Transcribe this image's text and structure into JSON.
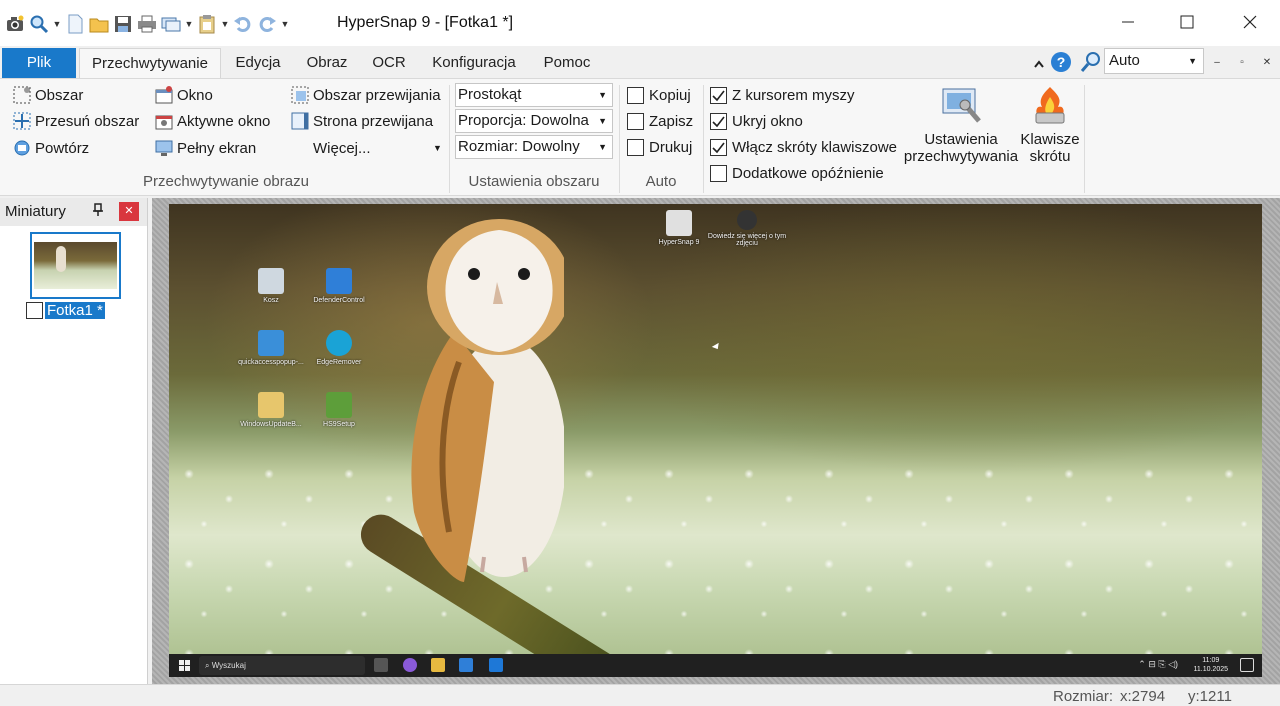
{
  "window": {
    "title": "HyperSnap 9 - [Fotka1 *]",
    "controls": [
      "minimize",
      "maximize",
      "close"
    ]
  },
  "quick_access": {
    "icons": [
      "camera-icon",
      "zoom-icon",
      "new-icon",
      "open-icon",
      "save-icon",
      "print-icon",
      "windows-icon",
      "clipboard-icon",
      "undo-icon",
      "redo-icon",
      "customize-icon"
    ]
  },
  "tabs": {
    "file": "Plik",
    "items": [
      "Przechwytywanie",
      "Edycja",
      "Obraz",
      "OCR",
      "Konfiguracja",
      "Pomoc"
    ],
    "active": "Przechwytywanie"
  },
  "zoom_select": {
    "value": "Auto"
  },
  "ribbon": {
    "capture_group": {
      "label": "Przechwytywanie obrazu",
      "col1": [
        "Obszar",
        "Przesuń obszar",
        "Powtórz"
      ],
      "col2": [
        "Okno",
        "Aktywne okno",
        "Pełny ekran"
      ],
      "col3": [
        "Obszar przewijania",
        "Strona przewijana",
        "Więcej..."
      ]
    },
    "area_group": {
      "label": "Ustawienia obszaru",
      "dropdowns": [
        "Prostokąt",
        "Proporcja: Dowolna",
        "Rozmiar: Dowolny"
      ]
    },
    "auto_group": {
      "label": "Auto",
      "checkboxes": [
        {
          "label": "Kopiuj",
          "checked": false
        },
        {
          "label": "Zapisz",
          "checked": false
        },
        {
          "label": "Drukuj",
          "checked": false
        }
      ]
    },
    "options": [
      {
        "label": "Z kursorem myszy",
        "checked": true
      },
      {
        "label": "Ukryj okno",
        "checked": true
      },
      {
        "label": "Włącz skróty klawiszowe",
        "checked": true
      },
      {
        "label": "Dodatkowe opóźnienie",
        "checked": false
      }
    ],
    "settings_button": {
      "line1": "Ustawienia",
      "line2": "przechwytywania"
    },
    "hotkeys_button": {
      "line1": "Klawisze",
      "line2": "skrótu"
    }
  },
  "thumbnails": {
    "title": "Miniatury",
    "pin_icon": "pin-icon",
    "close_icon": "close-icon",
    "items": [
      {
        "label": "Fotka1 *"
      }
    ]
  },
  "desktop": {
    "icons": [
      {
        "label": "Kosz",
        "color": "#cfd8e0"
      },
      {
        "label": "DefenderControl",
        "color": "#2f7fd8"
      },
      {
        "label": "quickaccesspopup-...",
        "color": "#3a8fd9"
      },
      {
        "label": "EdgeRemover",
        "color": "#1aa3d6"
      },
      {
        "label": "WindowsUpdateB...",
        "color": "#e7c66c"
      },
      {
        "label": "HS9Setup",
        "color": "#5d9e3a"
      },
      {
        "label": "HyperSnap 9",
        "color": "#e0e0e0"
      },
      {
        "label": "Dowiedz się więcej o tym zdjęciu",
        "color": "#333333"
      }
    ],
    "taskbar": {
      "search": "Wyszukaj",
      "time": "11:09",
      "date": "11.10.2025"
    }
  },
  "status": {
    "size_label": "Rozmiar:",
    "x": "x:2794",
    "y": "y:1211"
  },
  "colors": {
    "accent": "#1979ca",
    "close_red": "#d9363e"
  }
}
